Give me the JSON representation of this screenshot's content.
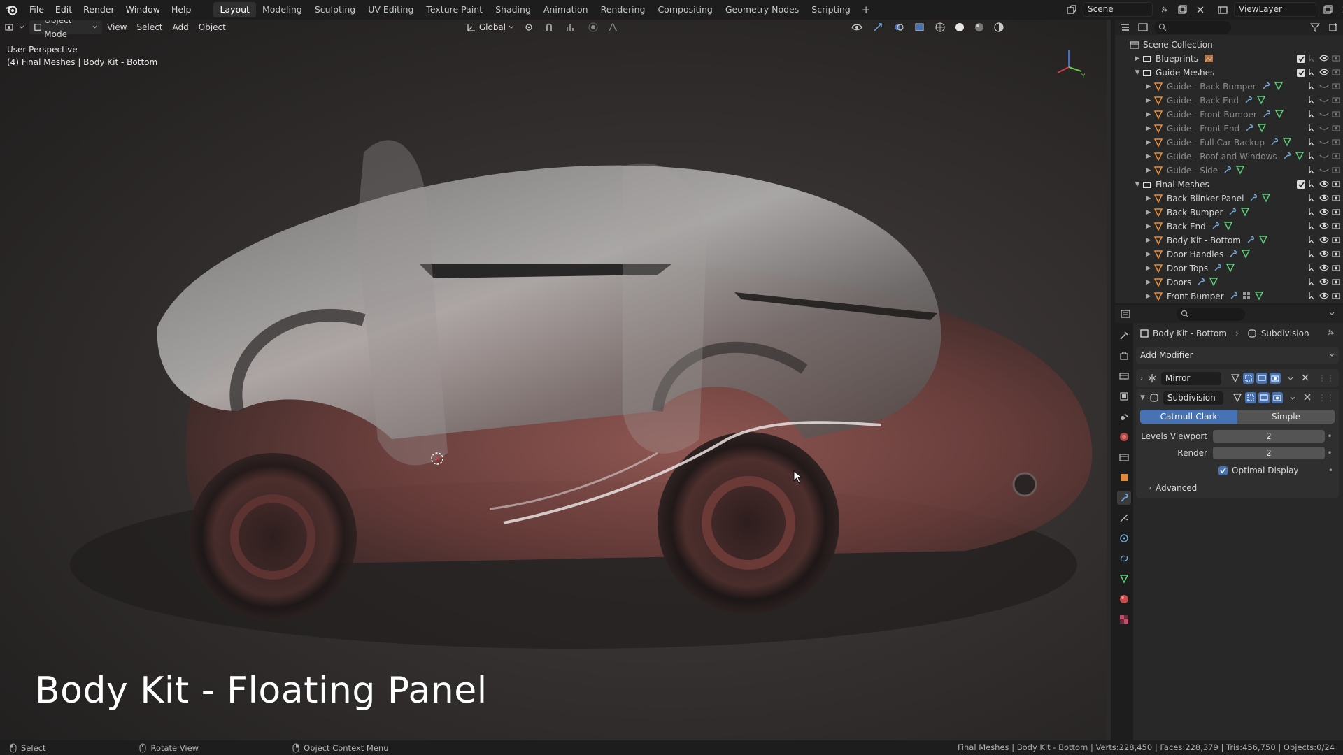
{
  "menu": {
    "items": [
      "File",
      "Edit",
      "Render",
      "Window",
      "Help"
    ]
  },
  "workspaces": {
    "tabs": [
      "Layout",
      "Modeling",
      "Sculpting",
      "UV Editing",
      "Texture Paint",
      "Shading",
      "Animation",
      "Rendering",
      "Compositing",
      "Geometry Nodes",
      "Scripting"
    ],
    "active": "Layout"
  },
  "scene": {
    "name": "Scene",
    "view_layer": "ViewLayer"
  },
  "viewport": {
    "mode": "Object Mode",
    "menus": [
      "View",
      "Select",
      "Add",
      "Object"
    ],
    "transform_orientation": "Global",
    "perspective_label": "User Perspective",
    "context_label": "(4) Final Meshes | Body Kit - Bottom",
    "caption": "Body Kit - Floating Panel",
    "gizmo_axes": {
      "x": "X",
      "y": "Y",
      "z": "Z"
    }
  },
  "outliner": {
    "root": "Scene Collection",
    "collections": [
      {
        "name": "Blueprints",
        "expanded": false,
        "children": []
      },
      {
        "name": "Guide Meshes",
        "expanded": true,
        "dim": true,
        "children": [
          "Guide - Back Bumper",
          "Guide - Back End",
          "Guide - Front Bumper",
          "Guide - Front End",
          "Guide - Full Car Backup",
          "Guide - Roof and Windows",
          "Guide - Side"
        ]
      },
      {
        "name": "Final Meshes",
        "expanded": true,
        "children": [
          "Back Blinker Panel",
          "Back Bumper",
          "Back End",
          "Body Kit - Bottom",
          "Door Handles",
          "Door Tops",
          "Doors",
          "Front Bumper"
        ]
      }
    ]
  },
  "properties": {
    "object_name": "Body Kit - Bottom",
    "modifier_context": "Subdivision",
    "add_modifier_label": "Add Modifier",
    "modifiers": {
      "mirror": {
        "name": "Mirror"
      },
      "subdivision": {
        "name": "Subdivision",
        "mode_on": "Catmull-Clark",
        "mode_off": "Simple",
        "levels_viewport_label": "Levels Viewport",
        "levels_viewport_value": "2",
        "render_label": "Render",
        "render_value": "2",
        "optimal_display_label": "Optimal Display",
        "advanced_label": "Advanced"
      }
    }
  },
  "statusbar": {
    "select": "Select",
    "rotate": "Rotate View",
    "context_menu": "Object Context Menu",
    "stats": "Final Meshes | Body Kit - Bottom | Verts:228,450 | Faces:228,379 | Tris:456,750 | Objects:0/24"
  },
  "colors": {
    "accent": "#4772b3",
    "mesh_icon": "#e08a3c",
    "modifier_icon": "#6fa8dc",
    "data_icon": "#5fd07a"
  }
}
